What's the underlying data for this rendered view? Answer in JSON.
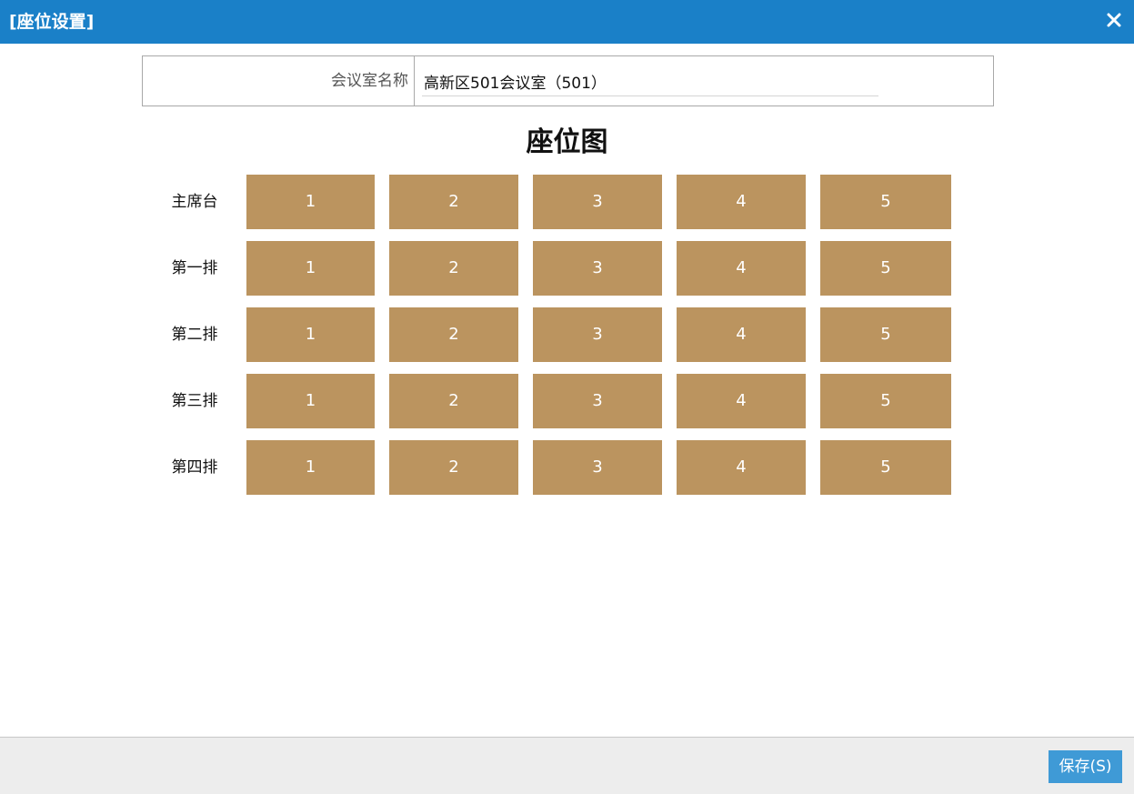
{
  "window": {
    "title": "[座位设置]",
    "close_icon": "close-icon"
  },
  "room": {
    "label": "会议室名称",
    "value": "高新区501会议室（501）"
  },
  "seat_map": {
    "title": "座位图",
    "seat_color": "#bb945f",
    "rows": [
      {
        "label": "主席台",
        "seats": [
          "1",
          "2",
          "3",
          "4",
          "5"
        ]
      },
      {
        "label": "第一排",
        "seats": [
          "1",
          "2",
          "3",
          "4",
          "5"
        ]
      },
      {
        "label": "第二排",
        "seats": [
          "1",
          "2",
          "3",
          "4",
          "5"
        ]
      },
      {
        "label": "第三排",
        "seats": [
          "1",
          "2",
          "3",
          "4",
          "5"
        ]
      },
      {
        "label": "第四排",
        "seats": [
          "1",
          "2",
          "3",
          "4",
          "5"
        ]
      }
    ]
  },
  "footer": {
    "save_label": "保存(S)"
  },
  "colors": {
    "titlebar": "#1a80c8",
    "seat": "#bb945f",
    "save_button": "#3f9ad6",
    "footer_bg": "#ededed"
  }
}
